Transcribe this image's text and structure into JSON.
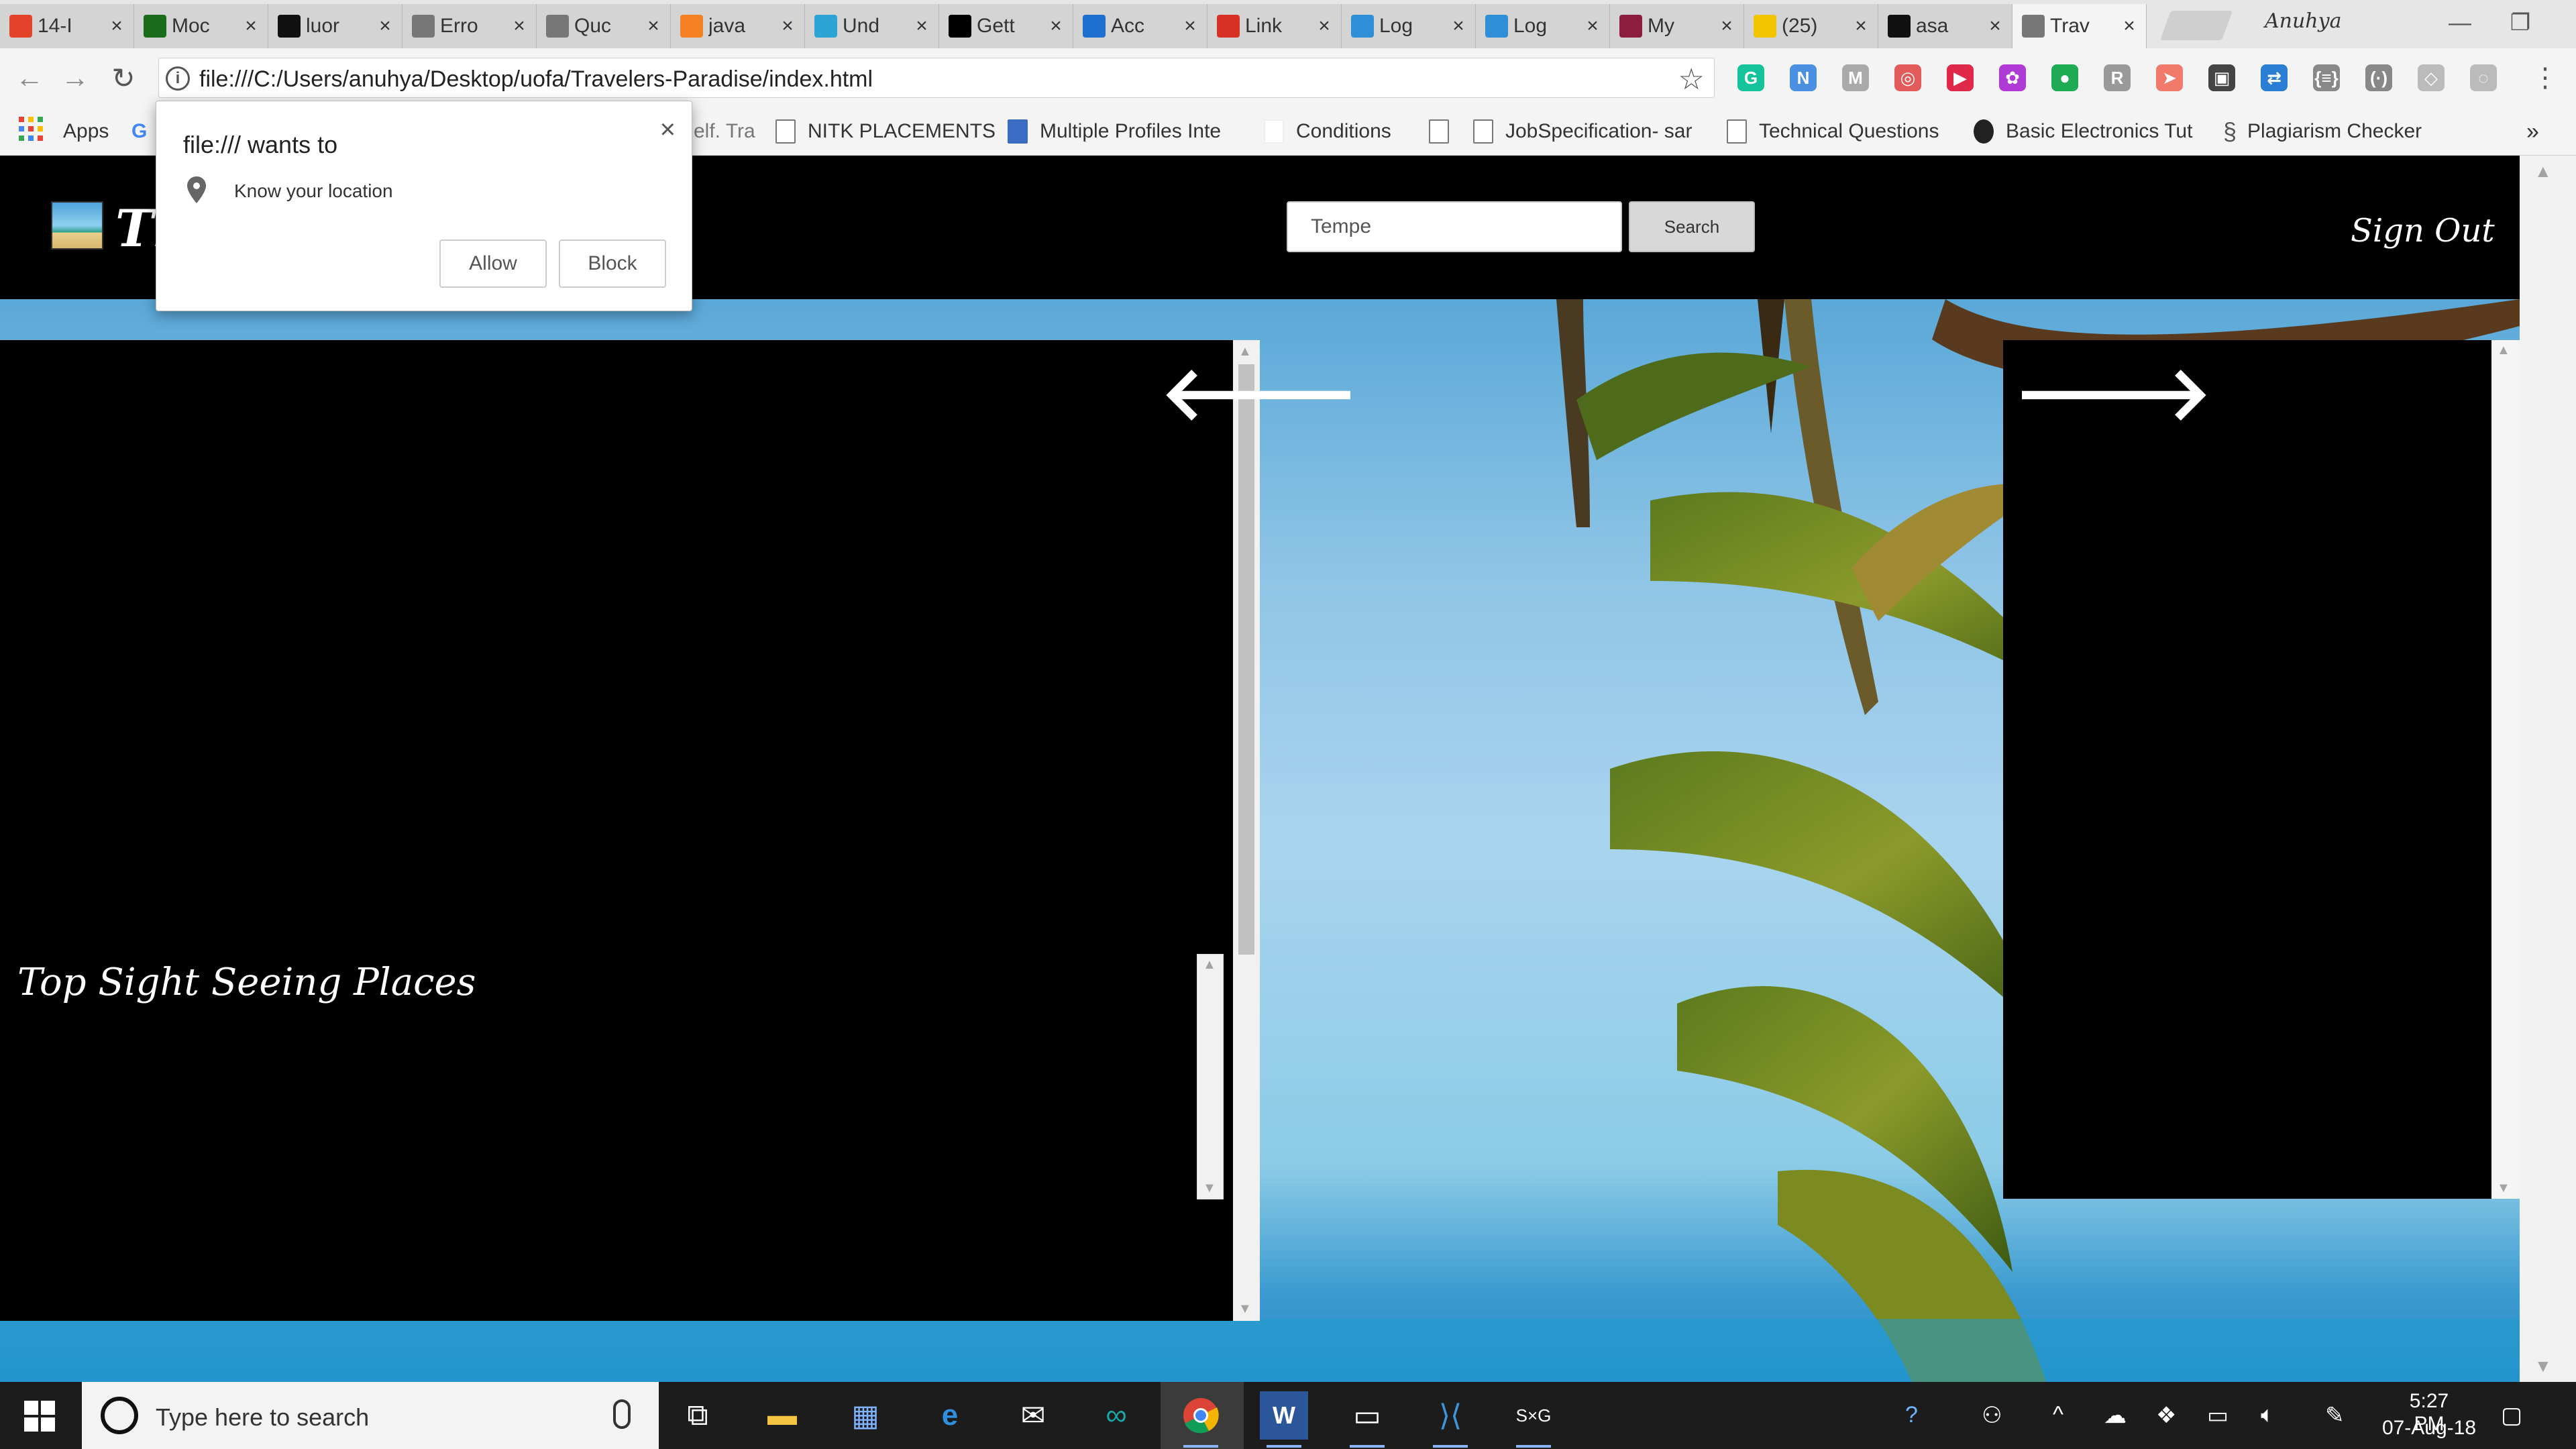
{
  "browser": {
    "tabs": [
      {
        "label": "14-I",
        "icon": "gitlab-icon",
        "color": "#e24329"
      },
      {
        "label": "Moc",
        "icon": "moodle-icon",
        "color": "#1a6b1a"
      },
      {
        "label": "luor",
        "icon": "github-icon",
        "color": "#111111"
      },
      {
        "label": "Erro",
        "icon": "page-icon",
        "color": "#777777"
      },
      {
        "label": "Quc",
        "icon": "page-icon",
        "color": "#777777"
      },
      {
        "label": "java",
        "icon": "stackoverflow-icon",
        "color": "#f48024"
      },
      {
        "label": "Und",
        "icon": "js-icon",
        "color": "#2ea3d6"
      },
      {
        "label": "Gett",
        "icon": "medium-icon",
        "color": "#000000"
      },
      {
        "label": "Acc",
        "icon": "x-icon",
        "color": "#1f6fd1"
      },
      {
        "label": "Link",
        "icon": "gmail-icon",
        "color": "#d93025"
      },
      {
        "label": "Log",
        "icon": "bulb-icon",
        "color": "#2f8fd6"
      },
      {
        "label": "Log",
        "icon": "bulb-icon",
        "color": "#2f8fd6"
      },
      {
        "label": "My",
        "icon": "asu-icon",
        "color": "#8c1d40"
      },
      {
        "label": "(25)",
        "icon": "bars-icon",
        "color": "#f2c500"
      },
      {
        "label": "asa",
        "icon": "github-icon",
        "color": "#111111"
      },
      {
        "label": "Trav",
        "icon": "page-icon",
        "color": "#777777"
      }
    ],
    "close_glyph": "×",
    "profile": "Anuhya",
    "url": "file:///C:/Users/anuhya/Desktop/uofa/Travelers-Paradise/index.html",
    "extensions": [
      {
        "label": "G",
        "color": "#15c39a"
      },
      {
        "label": "N",
        "color": "#4a90e2"
      },
      {
        "label": "M",
        "color": "#aaaaaa"
      },
      {
        "label": "◎",
        "color": "#e25a5a"
      },
      {
        "label": "▶",
        "color": "#e0284a"
      },
      {
        "label": "✿",
        "color": "#b03ad6"
      },
      {
        "label": "●",
        "color": "#1faa54"
      },
      {
        "label": "R",
        "color": "#999999"
      },
      {
        "label": "➤",
        "color": "#f27a6a"
      },
      {
        "label": "▣",
        "color": "#444444"
      },
      {
        "label": "⇄",
        "color": "#2a7fd4"
      },
      {
        "label": "{≡}",
        "color": "#888888"
      },
      {
        "label": "(·)",
        "color": "#888888"
      },
      {
        "label": "◇",
        "color": "#bbbbbb"
      },
      {
        "label": "◌",
        "color": "#bbbbbb"
      }
    ],
    "bookmarks": [
      {
        "label": "Apps"
      },
      {
        "label": "G"
      },
      {
        "label": "elf. Tra"
      },
      {
        "label": "NITK PLACEMENTS"
      },
      {
        "label": "Multiple Profiles Inte"
      },
      {
        "label": "Conditions"
      },
      {
        "label": "JobSpecification- sar"
      },
      {
        "label": "Technical Questions"
      },
      {
        "label": "Basic Electronics Tut"
      },
      {
        "label": "Plagiarism Checker"
      }
    ],
    "bookmarks_more": "»"
  },
  "permission": {
    "title": "file:/// wants to",
    "request": "Know your location",
    "allow": "Allow",
    "block": "Block",
    "close": "×"
  },
  "site": {
    "logo_text": "Tl",
    "search_value": "Tempe",
    "search_button": "Search",
    "signout": "Sign Out",
    "panel_heading": "Top Sight Seeing Places",
    "prev_arrow": "🡐",
    "next_arrow": "🡒"
  },
  "taskbar": {
    "search_placeholder": "Type here to search",
    "time": "5:27 PM",
    "date": "07-Aug-18",
    "apps": [
      "task-view",
      "file-explorer",
      "store",
      "edge",
      "mail",
      "arduino",
      "chrome",
      "word",
      "terminal",
      "vscode",
      "sxg"
    ]
  }
}
